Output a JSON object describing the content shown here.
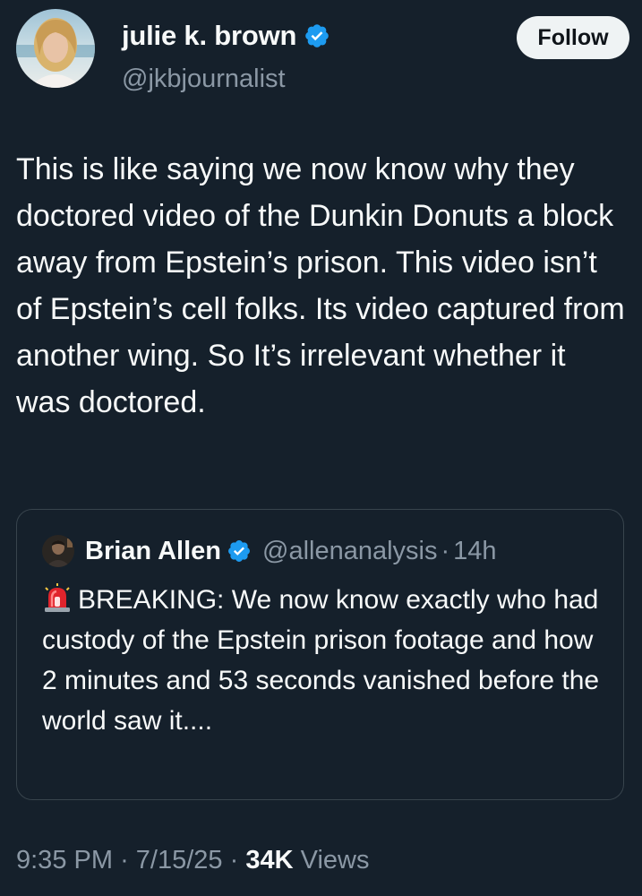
{
  "author": {
    "display_name": "julie k. brown",
    "handle": "@jkbjournalist",
    "verified_icon": "verified-badge-icon"
  },
  "follow_button": {
    "label": "Follow"
  },
  "tweet": {
    "text": "This is like saying we now know why they doctored video of the Dunkin Donuts a block away from Epstein’s prison. This video isn’t of Epstein’s cell folks. Its video captured from another wing. So It’s irrelevant whether it was doctored."
  },
  "quoted_tweet": {
    "display_name": "Brian Allen",
    "handle": "@allenanalysis",
    "separator": "·",
    "time": "14h",
    "emoji_icon": "police-siren-icon",
    "text": "BREAKING: We now know exactly who had custody of the Epstein prison footage and how 2 minutes and 53 seconds vanished before the world saw it...."
  },
  "meta": {
    "time": "9:35 PM",
    "separator1": "·",
    "date": "7/15/25",
    "separator2": "·",
    "views_count": "34K",
    "views_label": "Views"
  },
  "colors": {
    "background": "#15202b",
    "text": "#f7f9f9",
    "secondary": "#8b98a5",
    "border": "#38444d",
    "verified": "#1d9bf0"
  }
}
